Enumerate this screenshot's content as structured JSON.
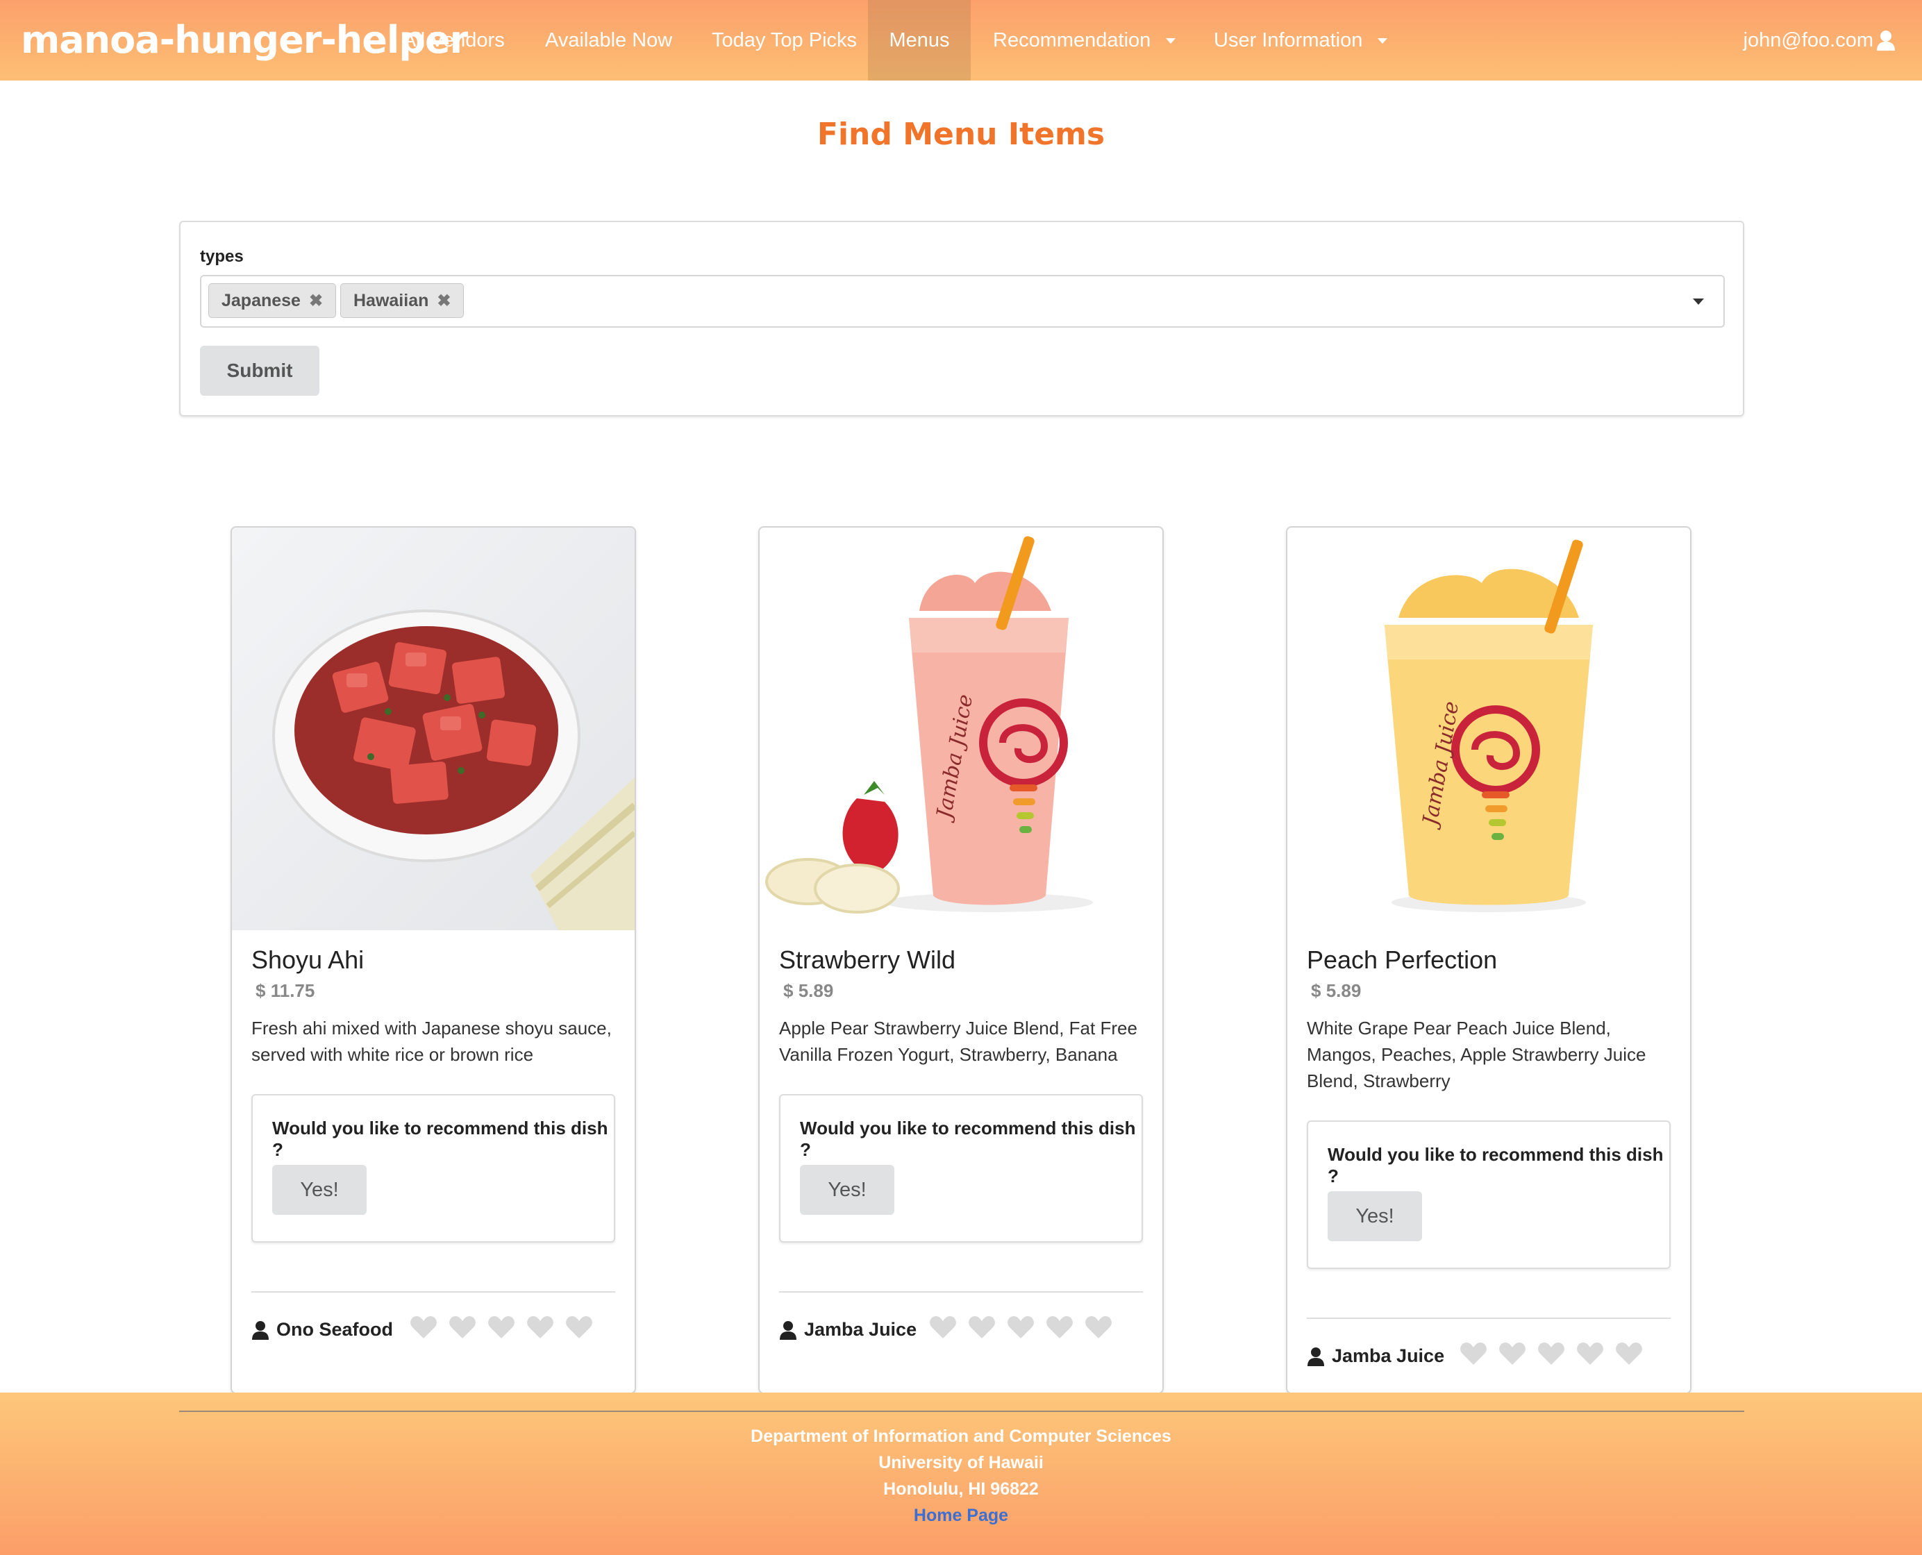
{
  "navbar": {
    "brand": "manoa-hunger-helper",
    "items": [
      {
        "label": "All Vendors"
      },
      {
        "label": "Available Now"
      },
      {
        "label": "Today Top Picks"
      },
      {
        "label": "Menus",
        "active": true
      },
      {
        "label": "Recommendation",
        "dropdown": true
      },
      {
        "label": "User Information",
        "dropdown": true
      }
    ],
    "user_email": "john@foo.com"
  },
  "page_title": "Find Menu Items",
  "filter": {
    "label": "types",
    "selected": [
      "Japanese",
      "Hawaiian"
    ],
    "remove_glyph": "✖",
    "submit_label": "Submit"
  },
  "cards": [
    {
      "name": "Shoyu Ahi",
      "price": "11.75",
      "currency": "$",
      "description": "Fresh ahi mixed with Japanese shoyu sauce, served with white rice or brown rice",
      "recommend_question": "Would you like to recommend this dish ?",
      "yes_label": "Yes!",
      "vendor": "Ono Seafood",
      "rating": 0
    },
    {
      "name": "Strawberry Wild",
      "price": "5.89",
      "currency": "$",
      "description": "Apple Pear Strawberry Juice Blend, Fat Free Vanilla Frozen Yogurt, Strawberry, Banana",
      "recommend_question": "Would you like to recommend this dish ?",
      "yes_label": "Yes!",
      "vendor": "Jamba Juice",
      "rating": 0
    },
    {
      "name": "Peach Perfection",
      "price": "5.89",
      "currency": "$",
      "description": "White Grape Pear Peach Juice Blend, Mangos, Peaches, Apple Strawberry Juice Blend, Strawberry",
      "recommend_question": "Would you like to recommend this dish ?",
      "yes_label": "Yes!",
      "vendor": "Jamba Juice",
      "rating": 0
    }
  ],
  "footer": {
    "line1": "Department of Information and Computer Sciences",
    "line2": "University of Hawaii",
    "line3": "Honolulu, HI 96822",
    "link": "Home Page"
  },
  "colors": {
    "accent": "#f0742a",
    "nav_gradient_top": "#fca06b",
    "nav_gradient_bottom": "#fdbf74",
    "heart_empty": "#d9d9d9",
    "link": "#3c6fd3"
  }
}
